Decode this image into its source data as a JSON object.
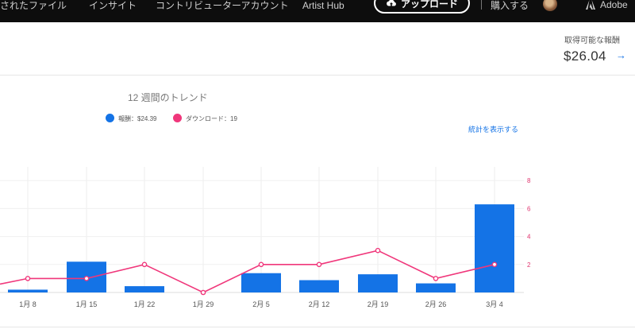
{
  "topbar": {
    "nav_items": [
      "されたファイル",
      "インサイト",
      "コントリビューターアカウント",
      "Artist Hub"
    ],
    "upload_label": "アップロード",
    "buy_label": "購入する",
    "brand": "Adobe"
  },
  "earnings": {
    "label": "取得可能な報酬",
    "amount": "$26.04"
  },
  "chart_title": "12 週間のトレンド",
  "legend": {
    "earnings": "報酬：$24.39",
    "downloads": "ダウンロード：19"
  },
  "stats_link": "統計を表示する",
  "colors": {
    "bar": "#1473e6",
    "line": "#f0377b",
    "accent": "#1473e6"
  },
  "chart_data": {
    "type": "bar",
    "title": "12 週間のトレンド",
    "categories": [
      "1月 8",
      "1月 15",
      "1月 22",
      "1月 29",
      "2月 5",
      "2月 12",
      "2月 19",
      "2月 26",
      "3月 4"
    ],
    "series": [
      {
        "name": "報酬",
        "type": "bar",
        "values": [
          0.2,
          2.2,
          0.45,
          0,
          1.38,
          0.88,
          1.3,
          0.65,
          6.3
        ]
      },
      {
        "name": "ダウンロード",
        "type": "line",
        "axis": "right",
        "values": [
          1,
          1,
          2,
          0,
          2,
          2,
          3,
          1,
          2
        ]
      }
    ],
    "right_axis_ticks": [
      "2",
      "4",
      "6",
      "8"
    ],
    "ylim": [
      0,
      8
    ],
    "grid": true
  }
}
